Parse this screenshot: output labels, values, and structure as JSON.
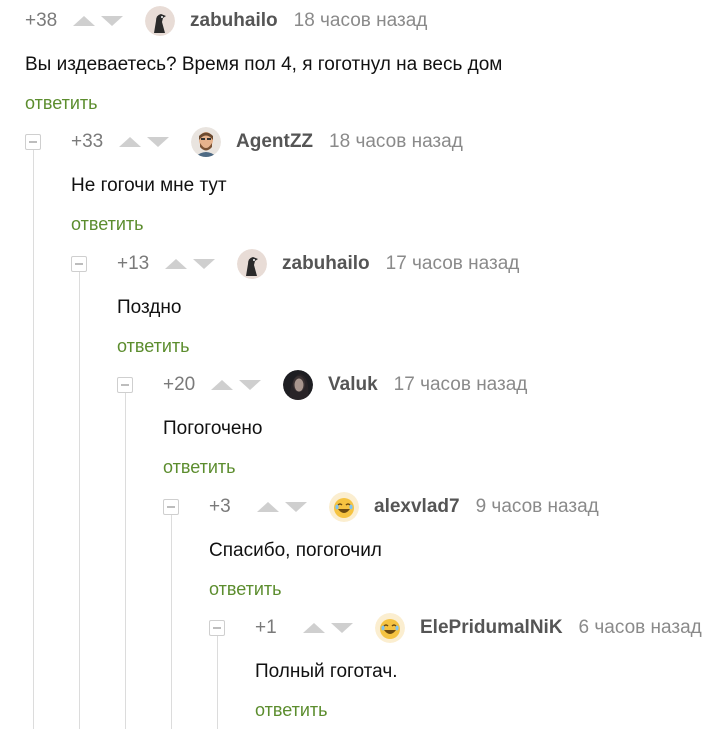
{
  "comments": [
    {
      "rating": "+38",
      "username": "zabuhailo",
      "time": "18 часов назад",
      "text": "Вы издеваетесь? Время пол 4, я гоготнул на весь дом",
      "reply": "ответить",
      "avatar_icon": "goose-avatar-icon"
    },
    {
      "rating": "+33",
      "username": "AgentZZ",
      "time": "18 часов назад",
      "text": "Не гогочи мне тут",
      "reply": "ответить",
      "avatar_icon": "bearded-man-avatar-icon"
    },
    {
      "rating": "+13",
      "username": "zabuhailo",
      "time": "17 часов назад",
      "text": "Поздно",
      "reply": "ответить",
      "avatar_icon": "goose-avatar-icon"
    },
    {
      "rating": "+20",
      "username": "Valuk",
      "time": "17 часов назад",
      "text": "Погогочено",
      "reply": "ответить",
      "avatar_icon": "dark-portrait-avatar-icon"
    },
    {
      "rating": "+3",
      "username": "alexvlad7",
      "time": "9 часов назад",
      "text": "Спасибо, погогочил",
      "reply": "ответить",
      "avatar_icon": "laughing-emoji-avatar-icon"
    },
    {
      "rating": "+1",
      "username": "ElePridumalNiK",
      "time": "6 часов назад",
      "text": "Полный гоготач.",
      "reply": "ответить",
      "avatar_icon": "laughing-emoji-avatar-icon"
    }
  ],
  "colors": {
    "reply_link": "#5c8d2e",
    "meta_text": "#8a8a8a",
    "username": "#555555",
    "vote_arrow": "#cfcfcf",
    "thread_line": "#dcdcdc"
  }
}
